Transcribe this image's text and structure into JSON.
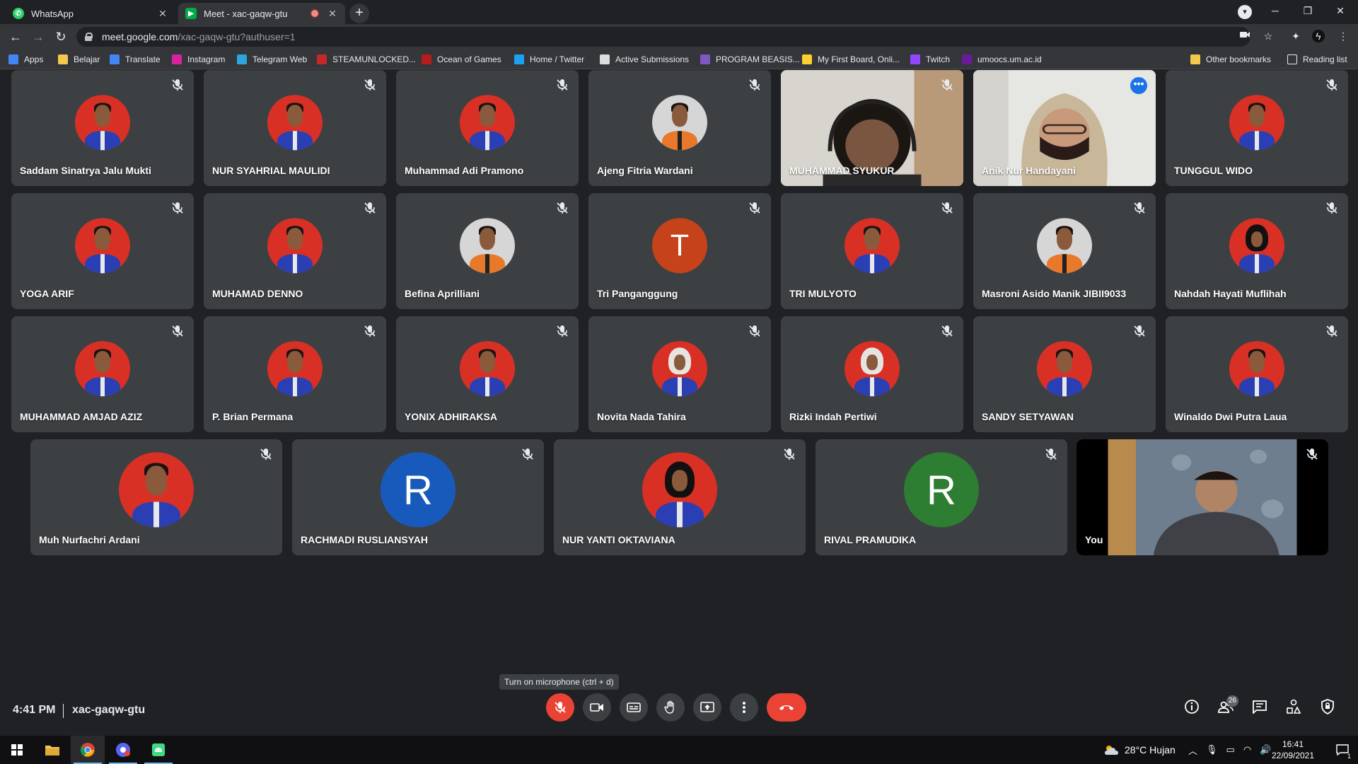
{
  "browser": {
    "tabs": [
      {
        "label": "WhatsApp",
        "icon": "whatsapp-icon",
        "color": "#25d366"
      },
      {
        "label": "Meet - xac-gaqw-gtu",
        "icon": "google-meet-icon",
        "color": "#00ac47"
      }
    ],
    "url_host": "meet.google.com",
    "url_path": "/xac-gaqw-gtu?authuser=1",
    "bookmarks": [
      {
        "label": "Apps",
        "icon": "apps-grid-icon",
        "color": "#4285f4"
      },
      {
        "label": "Belajar",
        "icon": "folder-icon",
        "color": "#f2c94c"
      },
      {
        "label": "Translate",
        "icon": "google-translate-icon",
        "color": "#4285f4"
      },
      {
        "label": "Instagram",
        "icon": "instagram-icon",
        "color": "#d6249f"
      },
      {
        "label": "Telegram Web",
        "icon": "telegram-icon",
        "color": "#2ca5e0"
      },
      {
        "label": "STEAMUNLOCKED...",
        "icon": "steamunlocked-icon",
        "color": "#c62828"
      },
      {
        "label": "Ocean of Games",
        "icon": "ocean-of-games-icon",
        "color": "#b71c1c"
      },
      {
        "label": "Home / Twitter",
        "icon": "twitter-icon",
        "color": "#1da1f2"
      },
      {
        "label": "Active Submissions",
        "icon": "pkp-icon",
        "color": "#dddddd"
      },
      {
        "label": "PROGRAM BEASIS...",
        "icon": "program-beasiswa-icon",
        "color": "#7e57c2"
      },
      {
        "label": "My First Board, Onli...",
        "icon": "miro-icon",
        "color": "#ffd02f"
      },
      {
        "label": "Twitch",
        "icon": "twitch-icon",
        "color": "#9146ff"
      },
      {
        "label": "umoocs.um.ac.id",
        "icon": "umoocs-icon",
        "color": "#6a1b9a"
      }
    ],
    "other_bookmarks": "Other bookmarks",
    "reading_list": "Reading list"
  },
  "participants_row1": [
    {
      "name": "Saddam Sinatrya Jalu Mukti",
      "kind": "photo"
    },
    {
      "name": "NUR SYAHRIAL MAULIDI",
      "kind": "photo"
    },
    {
      "name": "Muhammad Adi Pramono",
      "kind": "photo"
    },
    {
      "name": "Ajeng Fitria Wardani",
      "kind": "photo-light"
    },
    {
      "name": "MUHAMMAD SYUKUR",
      "kind": "video"
    },
    {
      "name": "Anik Nur Handayani",
      "kind": "video-speaking"
    },
    {
      "name": "TUNGGUL WIDO",
      "kind": "photo"
    }
  ],
  "participants_row2": [
    {
      "name": "YOGA ARIF",
      "kind": "photo"
    },
    {
      "name": "MUHAMAD DENNO",
      "kind": "photo"
    },
    {
      "name": "Befina Aprilliani",
      "kind": "photo-light"
    },
    {
      "name": "Tri Panganggung",
      "kind": "letter",
      "letter": "T",
      "color": "#c5421a"
    },
    {
      "name": "TRI MULYOTO",
      "kind": "photo"
    },
    {
      "name": "Masroni Asido Manik JIBII9033",
      "kind": "photo-light"
    },
    {
      "name": "Nahdah Hayati Muflihah",
      "kind": "photo-hijab-dark"
    }
  ],
  "participants_row3": [
    {
      "name": "MUHAMMAD AMJAD AZIZ",
      "kind": "photo"
    },
    {
      "name": "P. Brian Permana",
      "kind": "photo"
    },
    {
      "name": "YONIX ADHIRAKSA",
      "kind": "photo"
    },
    {
      "name": "Novita Nada Tahira",
      "kind": "photo-hijab"
    },
    {
      "name": "Rizki Indah Pertiwi",
      "kind": "photo-hijab"
    },
    {
      "name": "SANDY SETYAWAN",
      "kind": "photo"
    },
    {
      "name": "Winaldo Dwi Putra Laua",
      "kind": "photo"
    }
  ],
  "participants_row4": [
    {
      "name": "Muh Nurfachri Ardani",
      "kind": "photo"
    },
    {
      "name": "RACHMADI RUSLIANSYAH",
      "kind": "letter",
      "letter": "R",
      "color": "#185abc"
    },
    {
      "name": "NUR YANTI OKTAVIANA",
      "kind": "photo-hijab-dark"
    },
    {
      "name": "RIVAL PRAMUDIKA",
      "kind": "letter",
      "letter": "R",
      "color": "#2d7d32"
    },
    {
      "name": "You",
      "kind": "self-video"
    }
  ],
  "meet": {
    "time": "4:41 PM",
    "meeting_code": "xac-gaqw-gtu",
    "tooltip": "Turn on microphone (ctrl + d)",
    "participant_count": "26",
    "mic_state": "off"
  },
  "taskbar": {
    "weather": "28°C  Hujan",
    "time": "16:41",
    "date": "22/09/2021",
    "notification_count": "1"
  }
}
